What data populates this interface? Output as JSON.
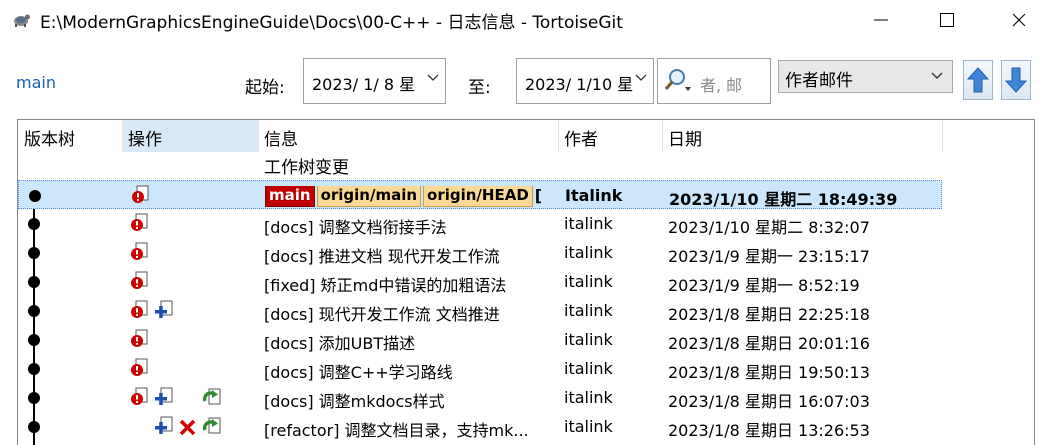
{
  "window": {
    "title": "E:\\ModernGraphicsEngineGuide\\Docs\\00-C++ - 日志信息 - TortoiseGit",
    "minimize_icon": "minimize-icon",
    "maximize_icon": "maximize-icon",
    "close_icon": "close-icon"
  },
  "filter": {
    "branch": "main",
    "from_label": "起始:",
    "from_date": "2023/  1/  8 星",
    "to_label": "至:",
    "to_date": "2023/  1/10 星",
    "search_placeholder": "者, 邮",
    "search_field": "作者邮件"
  },
  "columns": {
    "graph": "版本树",
    "actions": "操作",
    "message": "信息",
    "author": "作者",
    "date": "日期"
  },
  "working_tree": "工作树变更",
  "selected_refs": [
    "main",
    "origin/main",
    "origin/HEAD",
    "["
  ],
  "commits": [
    {
      "message": "",
      "author": "Italink",
      "date": "2023/1/10 星期二 18:49:39",
      "actions": [
        "modified"
      ]
    },
    {
      "message": "[docs] 调整文档衔接手法",
      "author": "italink",
      "date": "2023/1/10 星期二 8:32:07",
      "actions": [
        "modified"
      ]
    },
    {
      "message": "[docs] 推进文档 现代开发工作流",
      "author": "italink",
      "date": "2023/1/9 星期一 23:15:17",
      "actions": [
        "modified"
      ]
    },
    {
      "message": "[fixed] 矫正md中错误的加粗语法",
      "author": "italink",
      "date": "2023/1/9 星期一 8:52:19",
      "actions": [
        "modified"
      ]
    },
    {
      "message": "[docs] 现代开发工作流 文档推进",
      "author": "italink",
      "date": "2023/1/8 星期日 22:25:18",
      "actions": [
        "modified",
        "added"
      ]
    },
    {
      "message": "[docs] 添加UBT描述",
      "author": "italink",
      "date": "2023/1/8 星期日 20:01:16",
      "actions": [
        "modified"
      ]
    },
    {
      "message": "[docs] 调整C++学习路线",
      "author": "italink",
      "date": "2023/1/8 星期日 19:50:13",
      "actions": [
        "modified"
      ]
    },
    {
      "message": "[docs] 调整mkdocs样式",
      "author": "italink",
      "date": "2023/1/8 星期日 16:07:03",
      "actions": [
        "modified",
        "added",
        "replaced"
      ]
    },
    {
      "message": "[refactor] 调整文档目录，支持mk...",
      "author": "italink",
      "date": "2023/1/8 星期日 13:26:53",
      "actions": [
        "added",
        "deleted",
        "replaced"
      ]
    }
  ]
}
